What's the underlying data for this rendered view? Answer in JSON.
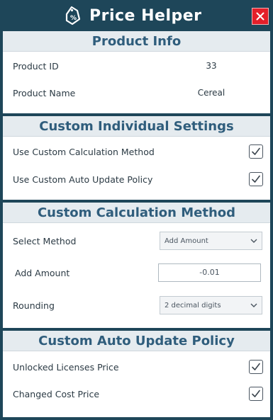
{
  "window": {
    "title": "Price Helper",
    "close_label": "close"
  },
  "sections": {
    "product_info": {
      "header": "Product Info",
      "product_id_label": "Product ID",
      "product_id_value": "33",
      "product_name_label": "Product Name",
      "product_name_value": "Cereal"
    },
    "individual_settings": {
      "header": "Custom Individual Settings",
      "use_calc_label": "Use Custom Calculation Method",
      "use_calc_checked": true,
      "use_policy_label": "Use Custom Auto Update Policy",
      "use_policy_checked": true
    },
    "calc_method": {
      "header": "Custom Calculation Method",
      "select_label": "Select Method",
      "select_value": "Add Amount",
      "amount_label": "Add Amount",
      "amount_value": "-0.01",
      "rounding_label": "Rounding",
      "rounding_value": "2 decimal digits"
    },
    "auto_update": {
      "header": "Custom Auto Update Policy",
      "unlocked_label": "Unlocked Licenses Price",
      "unlocked_checked": true,
      "cost_label": "Changed Cost Price",
      "cost_checked": true
    }
  },
  "colors": {
    "background": "#1e4659",
    "header_text": "#2f5d7c",
    "close_red": "#e31f2a"
  },
  "icons": [
    "price-tag-icon",
    "close-icon",
    "checkmark-icon",
    "chevron-down-icon"
  ]
}
